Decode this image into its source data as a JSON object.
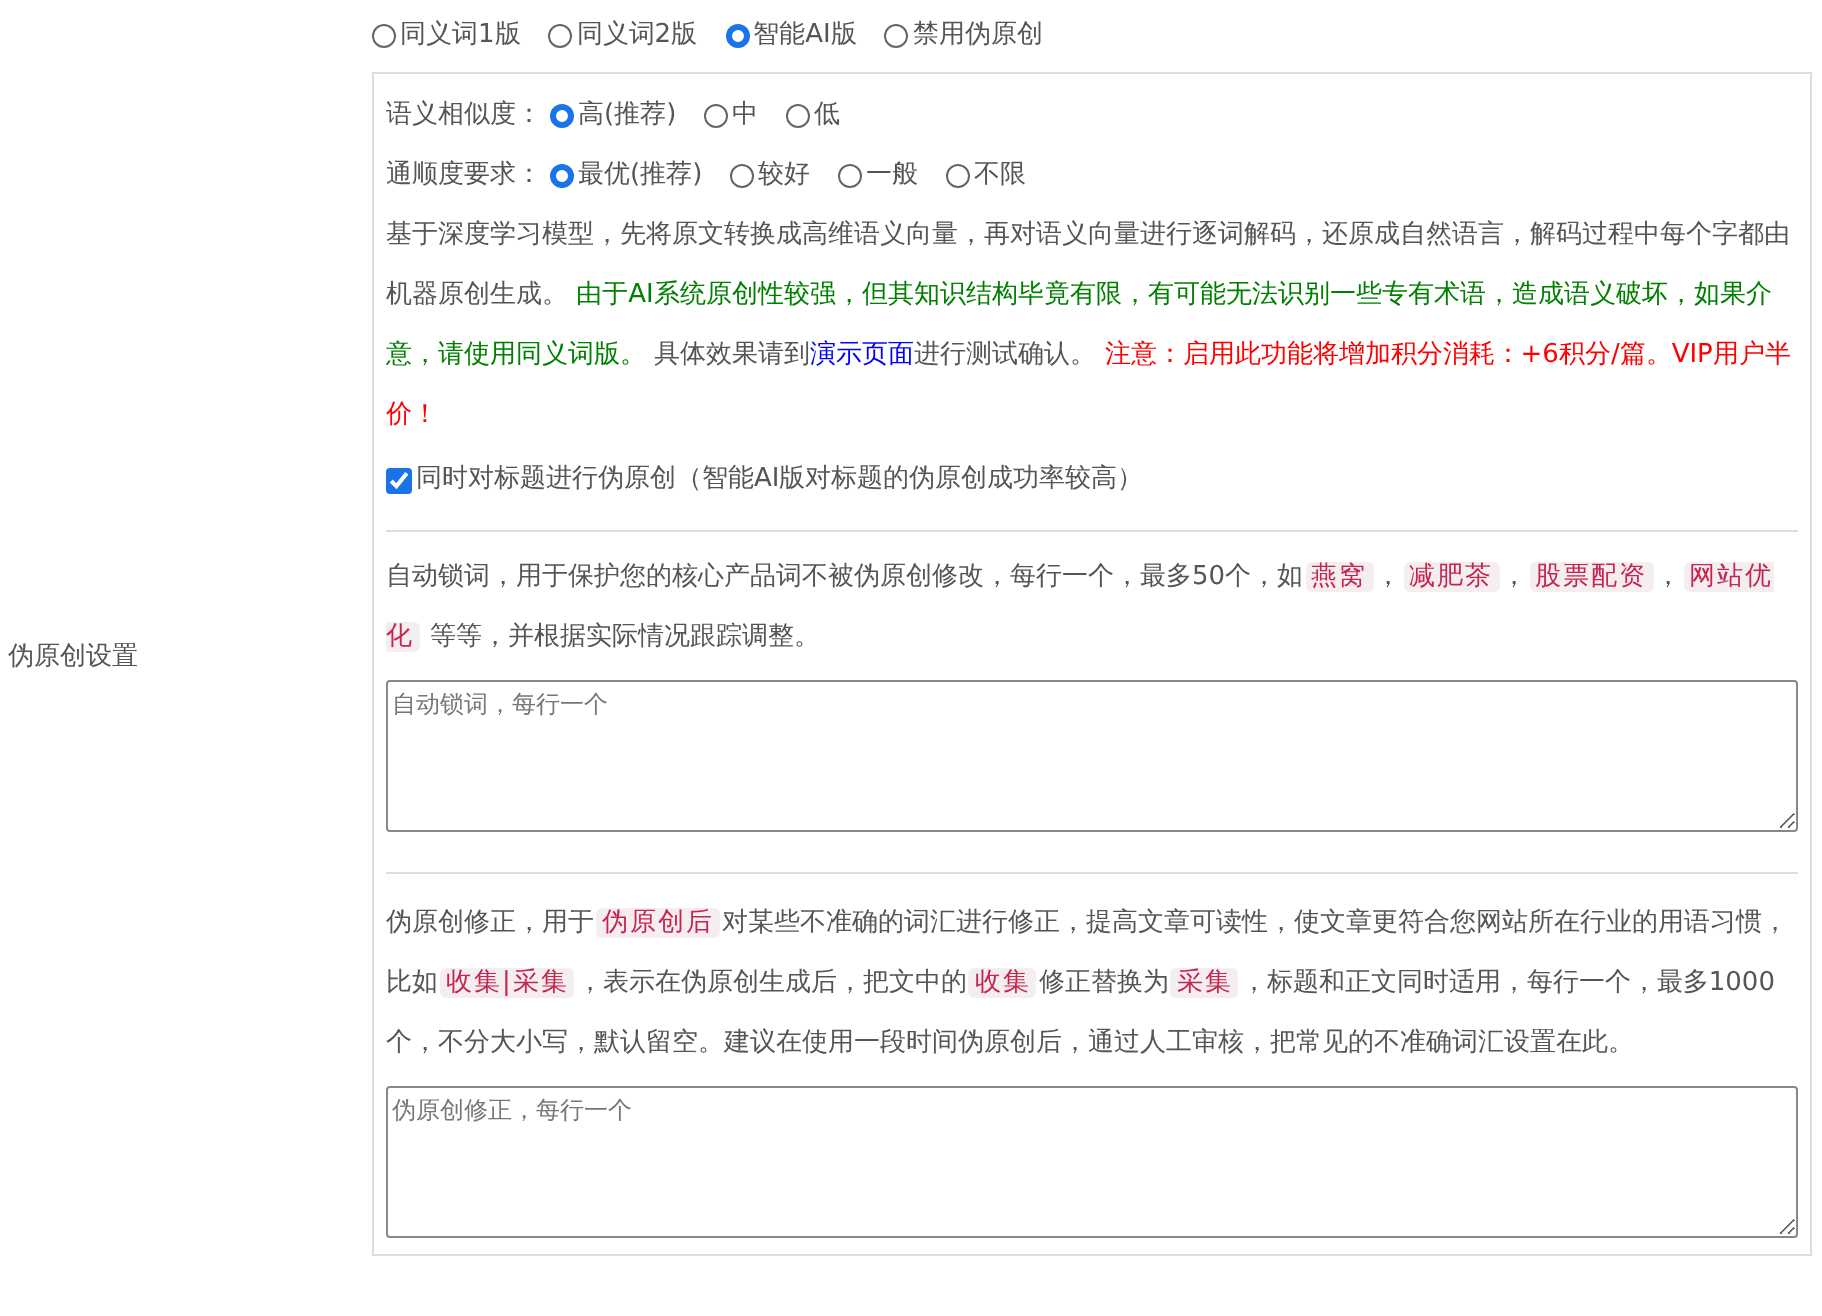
{
  "section_label": "伪原创设置",
  "modes": [
    {
      "label": "同义词1版",
      "selected": false
    },
    {
      "label": "同义词2版",
      "selected": false
    },
    {
      "label": "智能AI版",
      "selected": true
    },
    {
      "label": "禁用伪原创",
      "selected": false
    }
  ],
  "options": [
    {
      "label": "语义相似度：",
      "choices": [
        {
          "label": "高(推荐)",
          "selected": true
        },
        {
          "label": "中",
          "selected": false
        },
        {
          "label": "低",
          "selected": false
        }
      ]
    },
    {
      "label": "通顺度要求：",
      "choices": [
        {
          "label": "最优(推荐)",
          "selected": true
        },
        {
          "label": "较好",
          "selected": false
        },
        {
          "label": "一般",
          "selected": false
        },
        {
          "label": "不限",
          "selected": false
        }
      ]
    }
  ],
  "description": [
    {
      "kind": "plain",
      "text": "基于深度学习模型，先将原文转换成高维语义向量，再对语义向量进行逐词解码，还原成自然语言，解码过程中每个字都由机器原创生成。 "
    },
    {
      "kind": "note",
      "text": "由于AI系统原创性较强，但其知识结构毕竟有限，有可能无法识别一些专有术语，造成语义破坏，如果介意，请使用同义词版。"
    },
    {
      "kind": "plain",
      "text": " 具体效果请到"
    },
    {
      "kind": "link",
      "text": "演示页面"
    },
    {
      "kind": "plain",
      "text": "进行测试确认。 "
    },
    {
      "kind": "warning",
      "text": "注意：启用此功能将增加积分消耗：+6积分/篇。VIP用户半价！"
    }
  ],
  "title_checkbox": {
    "label": "同时对标题进行伪原创（智能AI版对标题的伪原创成功率较高）",
    "checked": true
  },
  "lock_words": {
    "description": [
      {
        "kind": "plain",
        "text": "自动锁词，用于保护您的核心产品词不被伪原创修改，每行一个，最多50个，如"
      },
      {
        "kind": "tag",
        "text": "燕窝"
      },
      {
        "kind": "plain",
        "text": "，"
      },
      {
        "kind": "tag",
        "text": "减肥茶"
      },
      {
        "kind": "plain",
        "text": "，"
      },
      {
        "kind": "tag",
        "text": "股票配资"
      },
      {
        "kind": "plain",
        "text": "，"
      },
      {
        "kind": "tag",
        "text": "网站优化"
      },
      {
        "kind": "plain",
        "text": " 等等，并根据实际情况跟踪调整。"
      }
    ],
    "placeholder": "自动锁词，每行一个"
  },
  "corrections": {
    "description": [
      {
        "kind": "plain",
        "text": "伪原创修正，用于"
      },
      {
        "kind": "tag",
        "text": "伪原创后"
      },
      {
        "kind": "plain",
        "text": "对某些不准确的词汇进行修正，提高文章可读性，使文章更符合您网站所在行业的用语习惯，比如"
      },
      {
        "kind": "tag",
        "text": "收集|采集"
      },
      {
        "kind": "plain",
        "text": "，表示在伪原创生成后，把文中的"
      },
      {
        "kind": "tag",
        "text": "收集"
      },
      {
        "kind": "plain",
        "text": "修正替换为"
      },
      {
        "kind": "tag",
        "text": "采集"
      },
      {
        "kind": "plain",
        "text": "，标题和正文同时适用，每行一个，最多1000个，不分大小写，默认留空。建议在使用一段时间伪原创后，通过人工审核，把常见的不准确词汇设置在此。"
      }
    ],
    "placeholder": "伪原创修正，每行一个"
  }
}
